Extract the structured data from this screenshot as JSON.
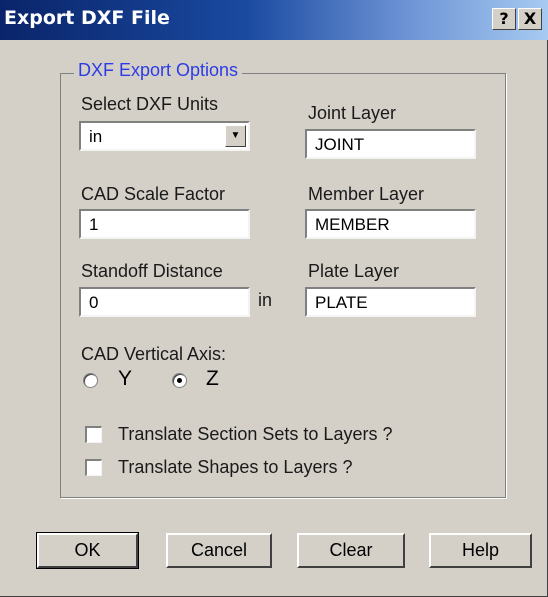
{
  "window": {
    "title": "Export DXF File",
    "help_label": "?",
    "close_label": "X"
  },
  "group": {
    "legend": "DXF Export Options",
    "legend_color": "#2d3ce6"
  },
  "units": {
    "label": "Select DXF Units",
    "value": "in",
    "dropdown_glyph": "▼"
  },
  "joint_layer": {
    "label": "Joint Layer",
    "value": "JOINT"
  },
  "scale": {
    "label": "CAD Scale Factor",
    "value": "1"
  },
  "member_layer": {
    "label": "Member Layer",
    "value": "MEMBER"
  },
  "standoff": {
    "label": "Standoff Distance",
    "value": "0",
    "unit": "in"
  },
  "plate_layer": {
    "label": "Plate Layer",
    "value": "PLATE"
  },
  "axis": {
    "label": "CAD Vertical Axis:",
    "options": [
      {
        "label": "Y",
        "selected": false
      },
      {
        "label": "Z",
        "selected": true
      }
    ]
  },
  "options": {
    "section_sets": {
      "label": "Translate Section Sets to Layers ?",
      "checked": false
    },
    "shapes": {
      "label": "Translate Shapes to Layers ?",
      "checked": false
    }
  },
  "buttons": {
    "ok": "OK",
    "cancel": "Cancel",
    "clear": "Clear",
    "help": "Help"
  }
}
